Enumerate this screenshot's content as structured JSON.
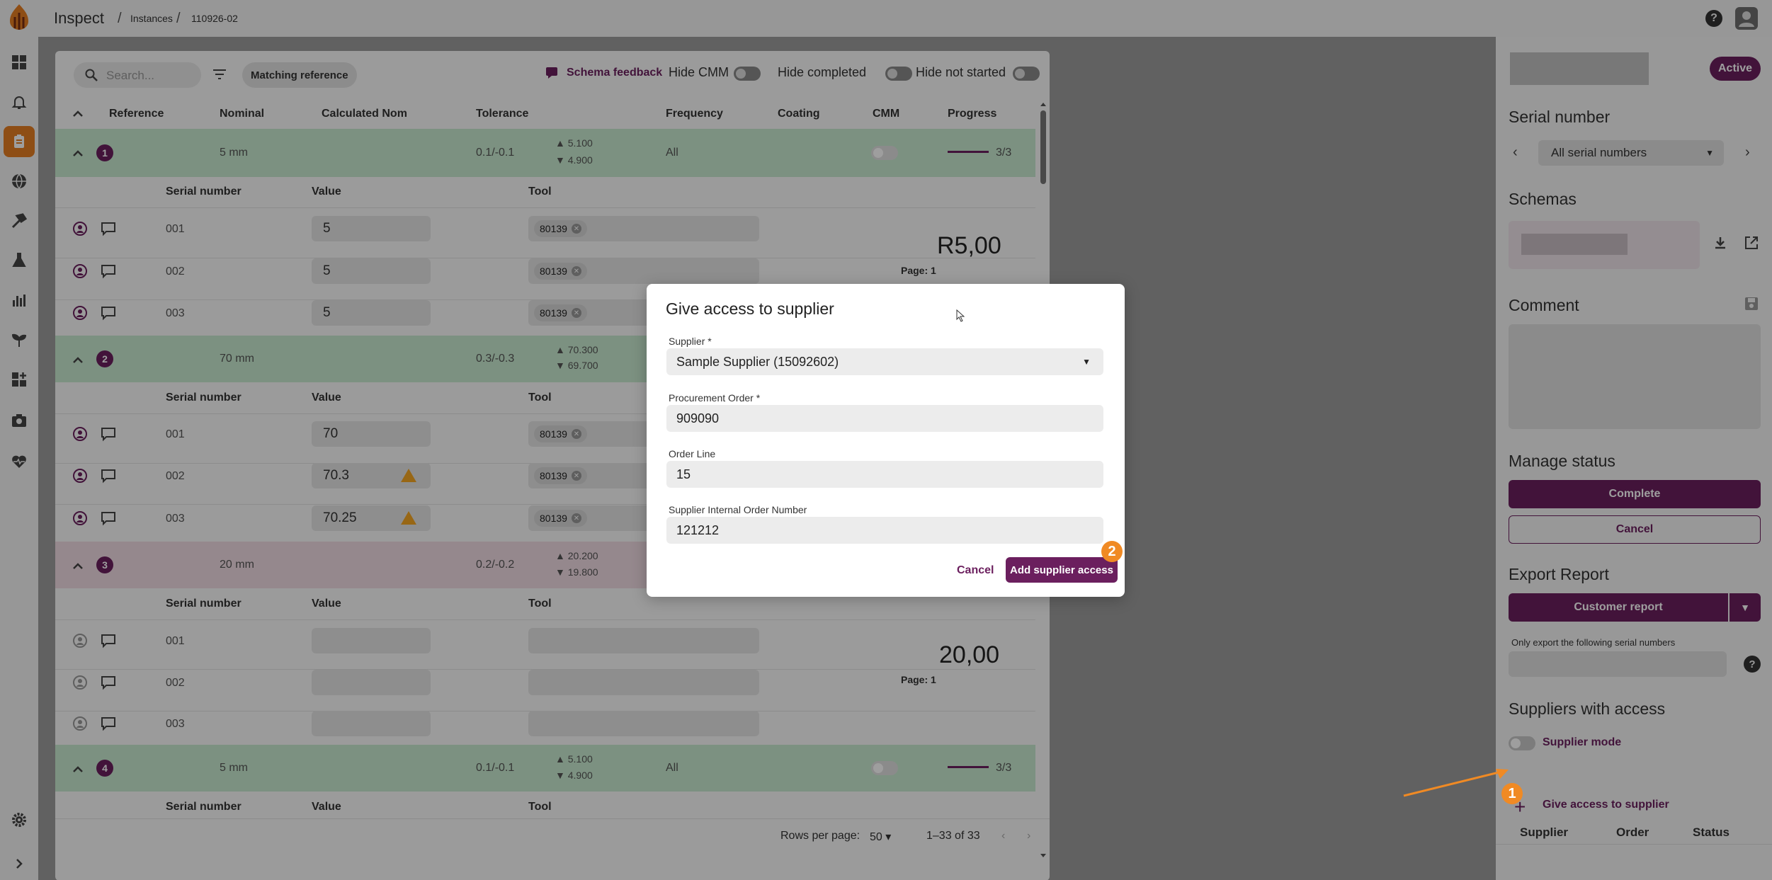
{
  "app": {
    "title": "Inspect"
  },
  "breadcrumbs": [
    "Instances",
    "110926-02"
  ],
  "toolbar": {
    "search_placeholder": "Search...",
    "matching_reference": "Matching reference",
    "schema_feedback": "Schema feedback",
    "hide_cmm": "Hide CMM",
    "hide_completed": "Hide completed",
    "hide_not_started": "Hide not started"
  },
  "table": {
    "columns": [
      "Reference",
      "Nominal",
      "Calculated Nom",
      "Tolerance",
      "Frequency",
      "Coating",
      "CMM",
      "Progress"
    ],
    "sub_columns": [
      "Serial number",
      "Value",
      "Tool"
    ],
    "groups": [
      {
        "index": "1",
        "nominal": "5 mm",
        "tolerance": "0.1/-0.1",
        "upper": "5.100",
        "lower": "4.900",
        "frequency": "All",
        "progress": "3/3",
        "progress_fraction": 1.0,
        "summary": "R5,00",
        "page": "Page: 1",
        "rows": [
          {
            "serial": "001",
            "value": "5",
            "tool": "80139"
          },
          {
            "serial": "002",
            "value": "5",
            "tool": "80139"
          },
          {
            "serial": "003",
            "value": "5",
            "tool": "80139"
          }
        ]
      },
      {
        "index": "2",
        "nominal": "70 mm",
        "tolerance": "0.3/-0.3",
        "upper": "70.300",
        "lower": "69.700",
        "rows": [
          {
            "serial": "001",
            "value": "70",
            "tool": "80139"
          },
          {
            "serial": "002",
            "value": "70.3",
            "tool": "80139"
          },
          {
            "serial": "003",
            "value": "70.25",
            "tool": "80139"
          }
        ]
      },
      {
        "index": "3",
        "nominal": "20 mm",
        "tolerance": "0.2/-0.2",
        "upper": "20.200",
        "lower": "19.800",
        "summary": "20,00",
        "page": "Page: 1",
        "rows": [
          {
            "serial": "001"
          },
          {
            "serial": "002"
          },
          {
            "serial": "003"
          }
        ]
      },
      {
        "index": "4",
        "nominal": "5 mm",
        "tolerance": "0.1/-0.1",
        "upper": "5.100",
        "lower": "4.900",
        "frequency": "All",
        "progress": "3/3",
        "progress_fraction": 1.0
      }
    ]
  },
  "pagination": {
    "rows_per_page_label": "Rows per page:",
    "rows_per_page": "50",
    "range": "1–33 of 33"
  },
  "dialog": {
    "title": "Give access to supplier",
    "supplier_label": "Supplier *",
    "supplier_value": "Sample Supplier (15092602)",
    "po_label": "Procurement Order *",
    "po_value": "909090",
    "order_line_label": "Order Line",
    "order_line_value": "15",
    "internal_label": "Supplier Internal Order Number",
    "internal_value": "121212",
    "cancel": "Cancel",
    "submit": "Add supplier access"
  },
  "right_panel": {
    "status_badge": "Active",
    "serial_title": "Serial number",
    "serial_select": "All serial numbers",
    "schemas_title": "Schemas",
    "comment_title": "Comment",
    "manage_status_title": "Manage status",
    "complete": "Complete",
    "cancel": "Cancel",
    "export_title": "Export Report",
    "customer_report": "Customer report",
    "only_export": "Only export the following serial numbers",
    "suppliers_title": "Suppliers with access",
    "supplier_mode": "Supplier mode",
    "give_access": "Give access to supplier",
    "supplier_columns": [
      "Supplier",
      "Order",
      "Status"
    ]
  },
  "annotations": [
    "1",
    "2"
  ],
  "colors": {
    "accent": "#6b1f5e",
    "brand_orange": "#e67e22",
    "annotation_orange": "#f08a24",
    "row_green": "#c8ebd0",
    "row_pink": "#f1dce4"
  }
}
